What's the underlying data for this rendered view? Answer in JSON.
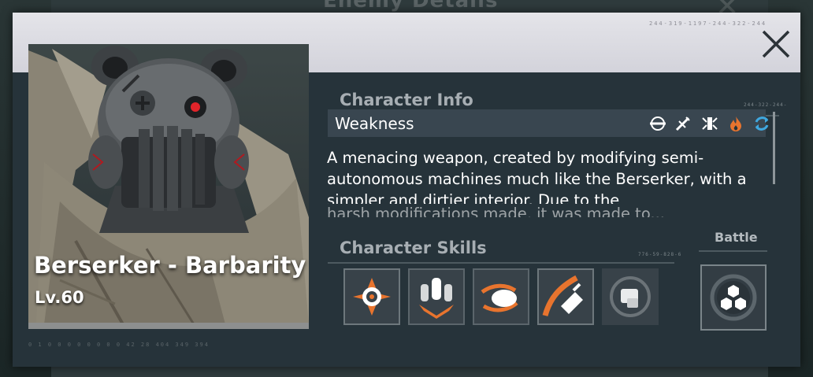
{
  "background": {
    "title": "Enemy Details"
  },
  "header": {
    "code": "244-319-1197-244-322-244"
  },
  "enemy": {
    "name": "Berserker - Barbarity",
    "level": "Lv.60"
  },
  "character_info": {
    "title": "Character Info",
    "code": "244-322-244-",
    "weakness_label": "Weakness",
    "weakness_icons": [
      "pierce-icon",
      "slash-icon",
      "physical-burst-icon",
      "fire-icon",
      "cycle-icon"
    ],
    "description": "A menacing weapon, created by modifying semi-autonomous machines much like the Berserker, with a simpler and dirtier interior. Due to the",
    "description_cutoff": "harsh modifications made, it was made to..."
  },
  "character_skills": {
    "title": "Character Skills",
    "code": "776-59-828-6",
    "skills": [
      {
        "icon": "crosshair-burst-icon"
      },
      {
        "icon": "missile-barrage-icon"
      },
      {
        "icon": "comet-dash-icon"
      },
      {
        "icon": "rocket-fist-icon"
      },
      {
        "icon": "shield-fist-icon"
      },
      {
        "icon": "striped-skill-icon"
      }
    ]
  },
  "battle": {
    "label": "Battle",
    "icon": "hexagon-cluster-icon"
  },
  "footer": {
    "code": "0 1 0 0 0 0 0 0 0 0 42 28 404 349 394"
  },
  "colors": {
    "accent_orange": "#e8742e",
    "accent_blue": "#3fa8e0",
    "panel": "#26333a",
    "header": "#dcdce3"
  }
}
